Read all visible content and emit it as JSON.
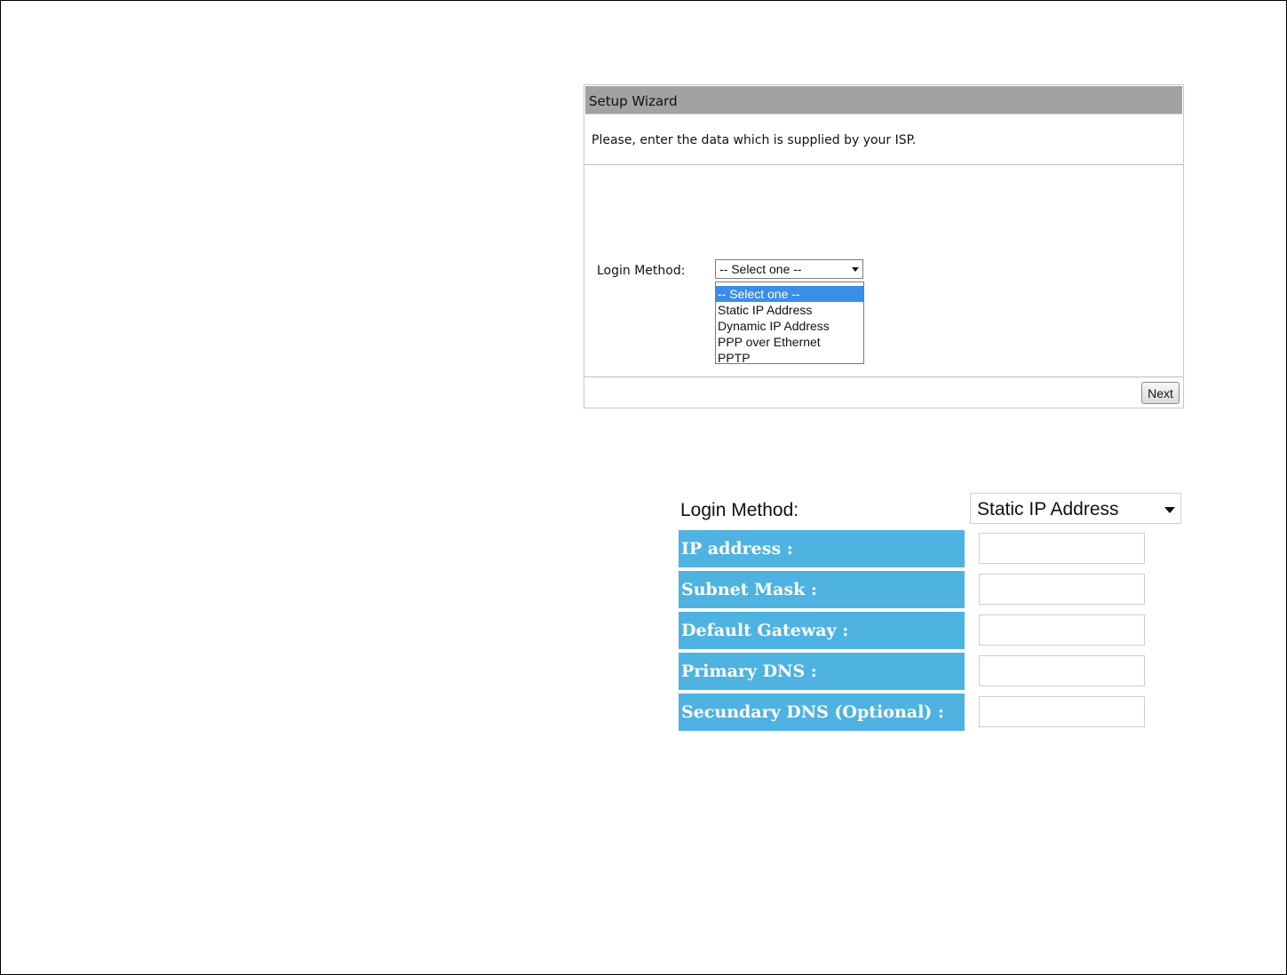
{
  "wizard": {
    "title": "Setup Wizard",
    "description": "Please, enter the data which is supplied by your ISP.",
    "login_label": "Login Method:",
    "select_value": "-- Select one --",
    "options": [
      "-- Select one --",
      "Static IP Address",
      "Dynamic IP Address",
      "PPP over Ethernet",
      "PPTP"
    ],
    "next_label": "Next"
  },
  "static_form": {
    "login_label": "Login Method:",
    "select_value": "Static IP Address",
    "fields": [
      {
        "label": "IP address :",
        "value": ""
      },
      {
        "label": "Subnet Mask :",
        "value": ""
      },
      {
        "label": "Default Gateway :",
        "value": ""
      },
      {
        "label": "Primary DNS :",
        "value": ""
      },
      {
        "label": "Secundary DNS (Optional) :",
        "value": ""
      }
    ]
  },
  "colors": {
    "header_bg": "#a2a2a2",
    "selected_option": "#3a8ee6",
    "field_label_bg": "#4eb3e0"
  }
}
